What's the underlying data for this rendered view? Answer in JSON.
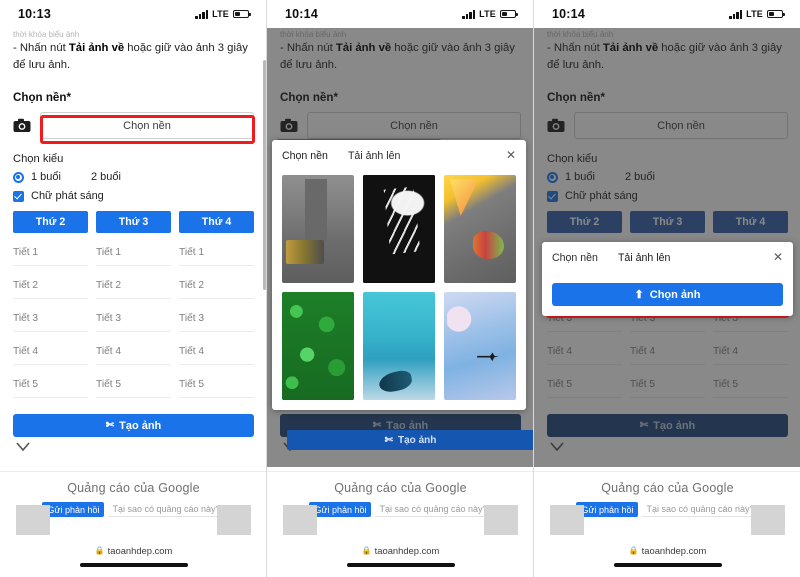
{
  "meta": {
    "site": "taoanhdep.com",
    "accent_blue": "#1a73e8",
    "highlight_red": "#ee1c1c",
    "dim_overlay": "rgba(40,40,40,0.55)"
  },
  "panels": [
    {
      "status": {
        "time": "10:13",
        "network": "LTE"
      },
      "page": {
        "cut_text": "thời khóa biểu ảnh",
        "instruction_prefix": "- Nhấn nút ",
        "instruction_bold": "Tải ảnh về",
        "instruction_suffix": " hoặc giữ vào ảnh 3 giây để lưu ảnh.",
        "background_label": "Chọn nền*",
        "background_button": "Chọn nền",
        "style_label": "Chọn kiểu",
        "radio_one": "1 buổi",
        "radio_two": "2 buổi",
        "checkbox_glow": "Chữ phát sáng",
        "days": [
          "Thứ 2",
          "Thứ 3",
          "Thứ 4"
        ],
        "periods": [
          "Tiết 1",
          "Tiết 2",
          "Tiết 3",
          "Tiết 4",
          "Tiết 5"
        ],
        "create_button": "Tạo ảnh"
      },
      "ad": {
        "title": "Quảng cáo của Google",
        "feedback": "Gửi phản hồi",
        "why": "Tại sao có quảng cáo này?"
      },
      "browser": {
        "url": "taoanhdep.com"
      }
    },
    {
      "status": {
        "time": "10:14",
        "network": "LTE"
      },
      "modal": {
        "tab_choose": "Chọn nền",
        "tab_upload": "Tải ảnh lên",
        "close": "✕",
        "thumbnails": [
          {
            "name": "city-street-background"
          },
          {
            "name": "black-sneakers-background"
          },
          {
            "name": "colorful-art-background"
          },
          {
            "name": "green-clover-background"
          },
          {
            "name": "turquoise-ocean-background"
          },
          {
            "name": "blue-sky-airplane-background"
          }
        ],
        "footer_button": "Tạo ảnh"
      }
    },
    {
      "status": {
        "time": "10:14",
        "network": "LTE"
      },
      "modal": {
        "tab_choose": "Chọn nền",
        "tab_upload": "Tải ảnh lên",
        "close": "✕",
        "pick_button": "Chọn ảnh"
      }
    }
  ]
}
